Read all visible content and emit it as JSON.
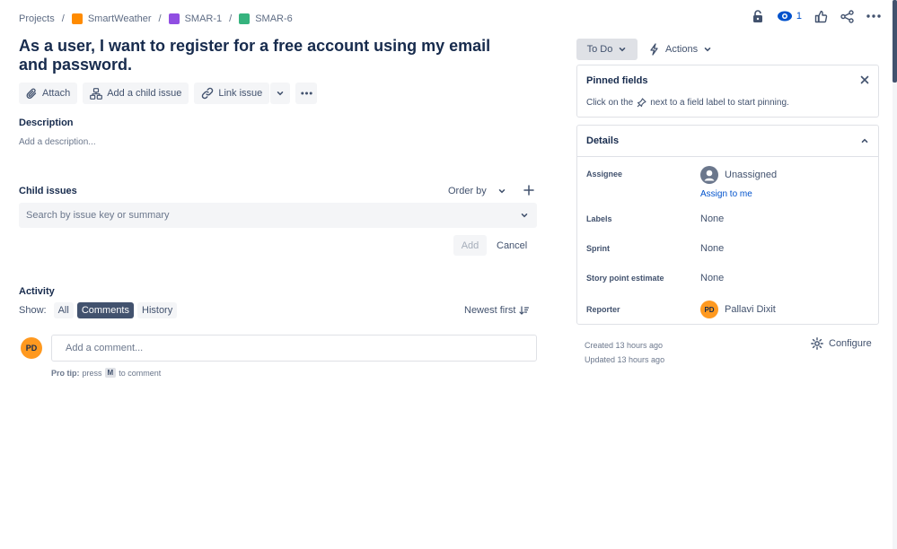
{
  "breadcrumb": {
    "projects": "Projects",
    "project": "SmartWeather",
    "epic": "SMAR-1",
    "issue": "SMAR-6"
  },
  "top_actions": {
    "watchers_count": "1"
  },
  "issue": {
    "title": "As a user, I want to register for a free account using my email and password."
  },
  "toolbar": {
    "attach": "Attach",
    "add_child": "Add a child issue",
    "link_issue": "Link issue"
  },
  "description": {
    "heading": "Description",
    "placeholder": "Add a description..."
  },
  "child_issues": {
    "heading": "Child issues",
    "order_by": "Order by",
    "search_placeholder": "Search by issue key or summary",
    "add_label": "Add",
    "cancel_label": "Cancel"
  },
  "activity": {
    "heading": "Activity",
    "show_label": "Show:",
    "filters": [
      "All",
      "Comments",
      "History"
    ],
    "active_filter": "Comments",
    "sort": "Newest first",
    "comment_placeholder": "Add a comment...",
    "avatar_initials": "PD",
    "protip_label": "Pro tip:",
    "protip_press": "press",
    "protip_key": "M",
    "protip_suffix": "to comment"
  },
  "status": {
    "label": "To Do",
    "actions_label": "Actions"
  },
  "pinned": {
    "title": "Pinned fields",
    "hint_before": "Click on the",
    "hint_after": "next to a field label to start pinning."
  },
  "details": {
    "title": "Details",
    "assignee_label": "Assignee",
    "assignee_value": "Unassigned",
    "assign_to_me": "Assign to me",
    "labels_label": "Labels",
    "labels_value": "None",
    "sprint_label": "Sprint",
    "sprint_value": "None",
    "story_points_label": "Story point estimate",
    "story_points_value": "None",
    "reporter_label": "Reporter",
    "reporter_initials": "PD",
    "reporter_value": "Pallavi Dixit"
  },
  "meta": {
    "created": "Created 13 hours ago",
    "updated": "Updated 13 hours ago",
    "configure": "Configure"
  },
  "colors": {
    "link": "#0052cc",
    "text": "#172b4d",
    "subtle": "#42526e",
    "avatar": "#ff991f",
    "active_chip": "#42526e"
  }
}
